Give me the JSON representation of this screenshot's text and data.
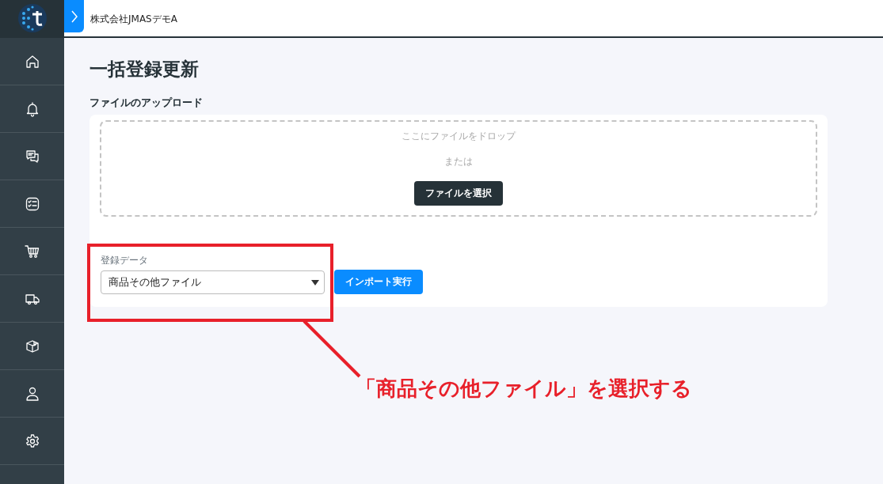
{
  "header": {
    "company": "株式会社JMASデモA"
  },
  "sidebar": {
    "items": [
      {
        "kind": "home"
      },
      {
        "kind": "bell"
      },
      {
        "kind": "chat"
      },
      {
        "kind": "checklist"
      },
      {
        "kind": "cart"
      },
      {
        "kind": "truck"
      },
      {
        "kind": "box"
      },
      {
        "kind": "user"
      },
      {
        "kind": "gear"
      }
    ]
  },
  "page": {
    "title": "一括登録更新",
    "section": "ファイルのアップロード",
    "dropzone": {
      "hint": "ここにファイルをドロップ",
      "or": "または",
      "button": "ファイルを選択"
    },
    "select": {
      "label": "登録データ",
      "value": "商品その他ファイル"
    },
    "import_button": "インポート実行"
  },
  "annotation": {
    "text": "「商品その他ファイル」を選択する"
  }
}
